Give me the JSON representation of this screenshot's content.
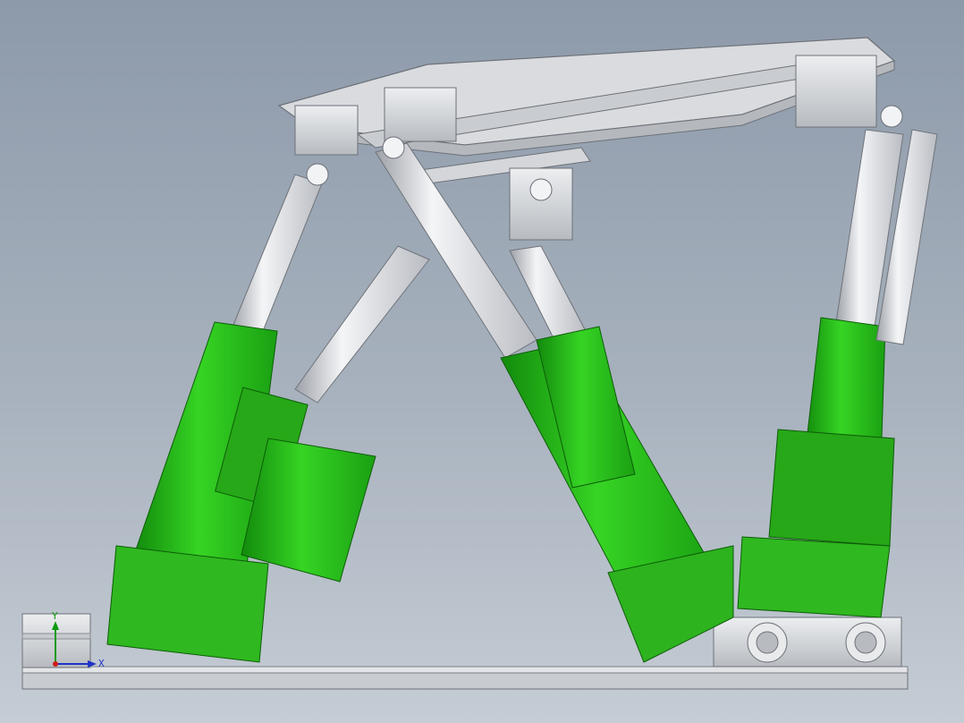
{
  "viewport": {
    "name": "3d-model-viewport",
    "model": "hexapod-stewart-platform"
  },
  "colors": {
    "background_top": "#8d9aaa",
    "background_bottom": "#c5ccd4",
    "actuator_green": "#2fc21f",
    "actuator_green_dark": "#128a0c",
    "rod_silver": "#e4e6ea",
    "frame_gray": "#d9dbde"
  },
  "triad": {
    "y_label": "Y",
    "x_label": "X",
    "icon": "coordinate-triad-icon"
  }
}
